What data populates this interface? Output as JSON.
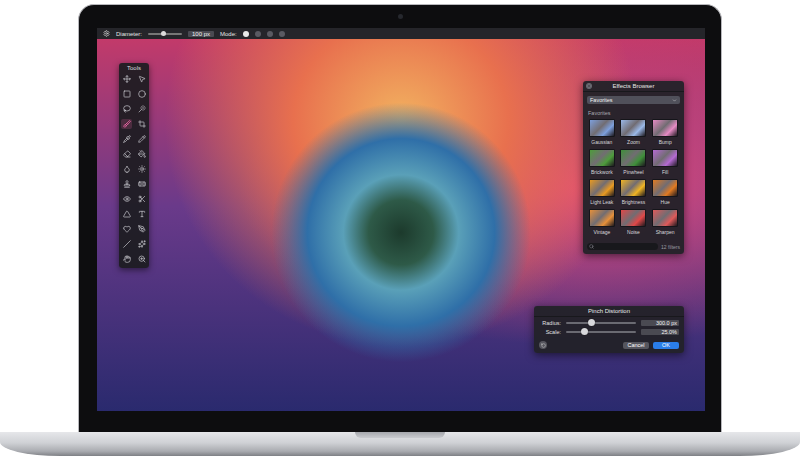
{
  "toolbar": {
    "brush_settings": {
      "label": "Diameter:",
      "level": 0.45,
      "value": "100 px"
    },
    "mode": {
      "label": "Mode:",
      "options": [
        {
          "selected": true
        },
        {
          "selected": false
        },
        {
          "selected": false
        },
        {
          "selected": false
        }
      ]
    }
  },
  "tools_palette": {
    "title": "Tools",
    "tools": [
      {
        "selected": false
      },
      {
        "selected": false
      },
      {
        "selected": false
      },
      {
        "selected": false
      },
      {
        "selected": false
      },
      {
        "selected": false
      },
      {
        "selected": true
      },
      {
        "selected": false
      },
      {
        "selected": false
      },
      {
        "selected": false
      },
      {
        "selected": false
      },
      {
        "selected": false
      },
      {
        "selected": false
      },
      {
        "selected": false
      },
      {
        "selected": false
      },
      {
        "selected": false
      },
      {
        "selected": false
      },
      {
        "selected": false
      },
      {
        "selected": false
      },
      {
        "selected": false
      },
      {
        "selected": false
      },
      {
        "selected": false
      },
      {
        "selected": false
      },
      {
        "selected": false
      },
      {
        "selected": false
      },
      {
        "selected": false
      }
    ]
  },
  "effects_browser": {
    "title": "Effects Browser",
    "dropdown": "Favorites",
    "section": "Favorites",
    "effects": [
      {
        "name": "Gaussian",
        "color": "#7d9fdc"
      },
      {
        "name": "Zoom",
        "color": "#9ab8e8"
      },
      {
        "name": "Bump",
        "color": "#e68ac4"
      },
      {
        "name": "Brickwork",
        "color": "#4e9c3c"
      },
      {
        "name": "Pinwheel",
        "color": "#3f8f3a"
      },
      {
        "name": "Fill",
        "color": "#b46ad2"
      },
      {
        "name": "Light Leak",
        "color": "#e89a22"
      },
      {
        "name": "Brightness",
        "color": "#f0b424"
      },
      {
        "name": "Hue",
        "color": "#e07a22"
      },
      {
        "name": "Vintage",
        "color": "#e6903a"
      },
      {
        "name": "Noise",
        "color": "#e04848"
      },
      {
        "name": "Sharpen",
        "color": "#de5a5a"
      }
    ],
    "search": {
      "placeholder": ""
    },
    "count": "12 filters"
  },
  "pinch_distortion": {
    "title": "Pinch Distortion",
    "sliders": [
      {
        "label": "Radius:",
        "level": 0.35,
        "reading": "300.0 px"
      },
      {
        "label": "Scale:",
        "level": 0.25,
        "reading": "25.0%"
      }
    ],
    "buttons": [
      {
        "label": "Cancel",
        "default": false
      },
      {
        "label": "OK",
        "default": true
      }
    ]
  }
}
